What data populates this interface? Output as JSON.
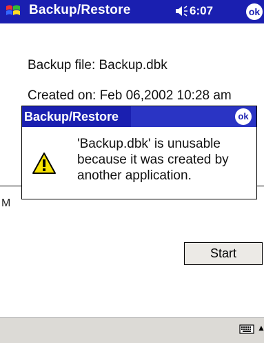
{
  "titlebar": {
    "title": "Backup/Restore",
    "time": "6:07",
    "ok_label": "ok"
  },
  "content": {
    "backup_file": "Backup file: Backup.dbk",
    "created_on": "Created on: Feb 06,2002 10:28 am",
    "hidden_label_fragment": "M"
  },
  "dialog": {
    "title": "Backup/Restore",
    "ok_label": "ok",
    "message": "'Backup.dbk' is unusable because it was created by another application."
  },
  "buttons": {
    "start_label": "Start"
  },
  "colors": {
    "titlebar": "#1a1fb0",
    "bottombar": "#dcdad6"
  },
  "icons": [
    "windows-start-icon",
    "speaker-icon",
    "ok-icon",
    "warning-icon",
    "keyboard-icon",
    "up-arrow-icon"
  ]
}
